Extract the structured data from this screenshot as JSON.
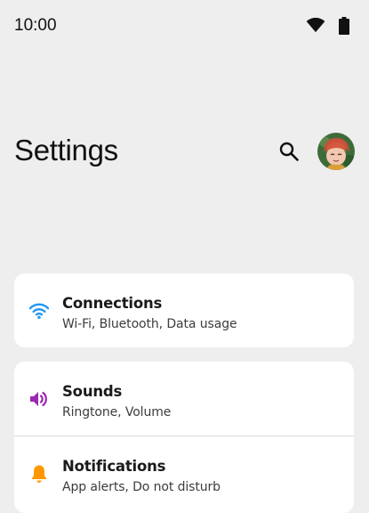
{
  "status_bar": {
    "time": "10:00",
    "icons": [
      "wifi-icon",
      "battery-icon"
    ]
  },
  "header": {
    "title": "Settings",
    "search_icon": "search-icon",
    "avatar": "avatar"
  },
  "groups": [
    {
      "items": [
        {
          "title": "Connections",
          "subtitle": "Wi-Fi, Bluetooth, Data usage",
          "icon": "wifi-icon",
          "icon_color": "#2196f3"
        }
      ]
    },
    {
      "items": [
        {
          "title": "Sounds",
          "subtitle": "Ringtone, Volume",
          "icon": "volume-icon",
          "icon_color": "#9c27b0"
        },
        {
          "title": "Notifications",
          "subtitle": "App alerts, Do not disturb",
          "icon": "bell-icon",
          "icon_color": "#ff9800"
        }
      ]
    }
  ]
}
